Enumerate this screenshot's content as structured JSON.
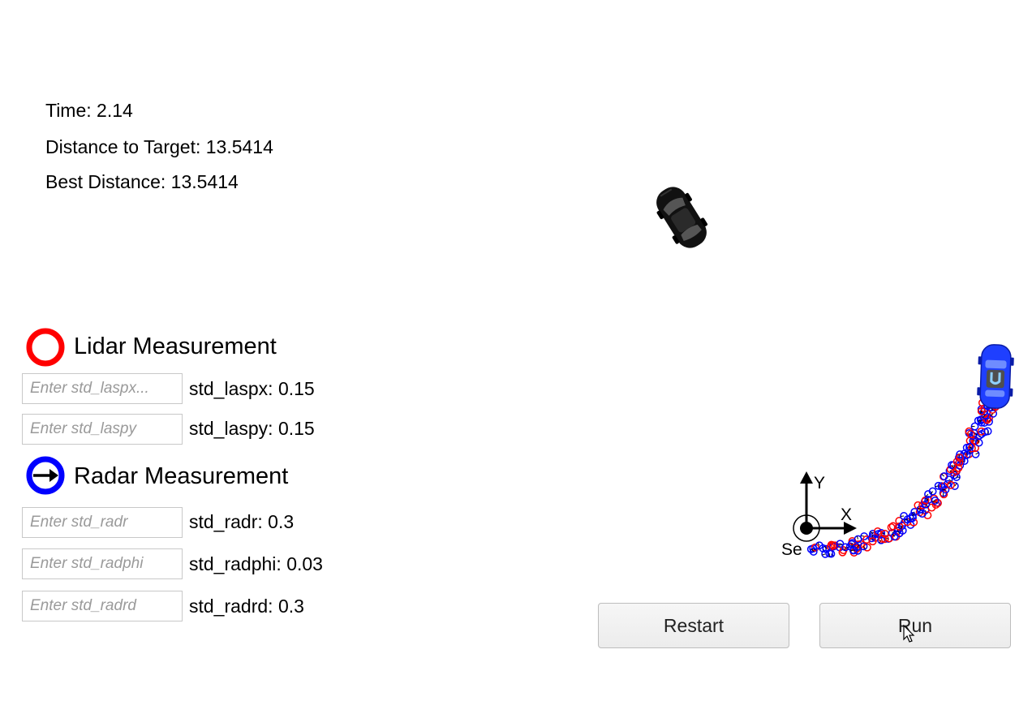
{
  "stats": {
    "time": "Time: 2.14",
    "distance": "Distance to Target: 13.5414",
    "best": "Best Distance: 13.5414"
  },
  "lidar": {
    "title": "Lidar Measurement",
    "icon": "red-ring-icon",
    "color": "#ff0000",
    "fields": [
      {
        "placeholder": "Enter std_laspx...",
        "label": "std_laspx: 0.15"
      },
      {
        "placeholder": "Enter std_laspy",
        "label": "std_laspy: 0.15"
      }
    ]
  },
  "radar": {
    "title": "Radar Measurement",
    "icon": "blue-ring-arrow-icon",
    "color": "#0000ff",
    "fields": [
      {
        "placeholder": "Enter std_radr",
        "label": "std_radr: 0.3"
      },
      {
        "placeholder": "Enter std_radphi",
        "label": "std_radphi: 0.03"
      },
      {
        "placeholder": "Enter std_radrd",
        "label": "std_radrd: 0.3"
      }
    ]
  },
  "sensor": {
    "label": "Se",
    "x_label": "X",
    "y_label": "Y"
  },
  "buttons": {
    "restart": "Restart",
    "run": "Run"
  },
  "colors": {
    "target_car": "#111111",
    "ego_car": "#1f3fff",
    "lidar": "#ff0000",
    "radar": "#0000ff"
  }
}
